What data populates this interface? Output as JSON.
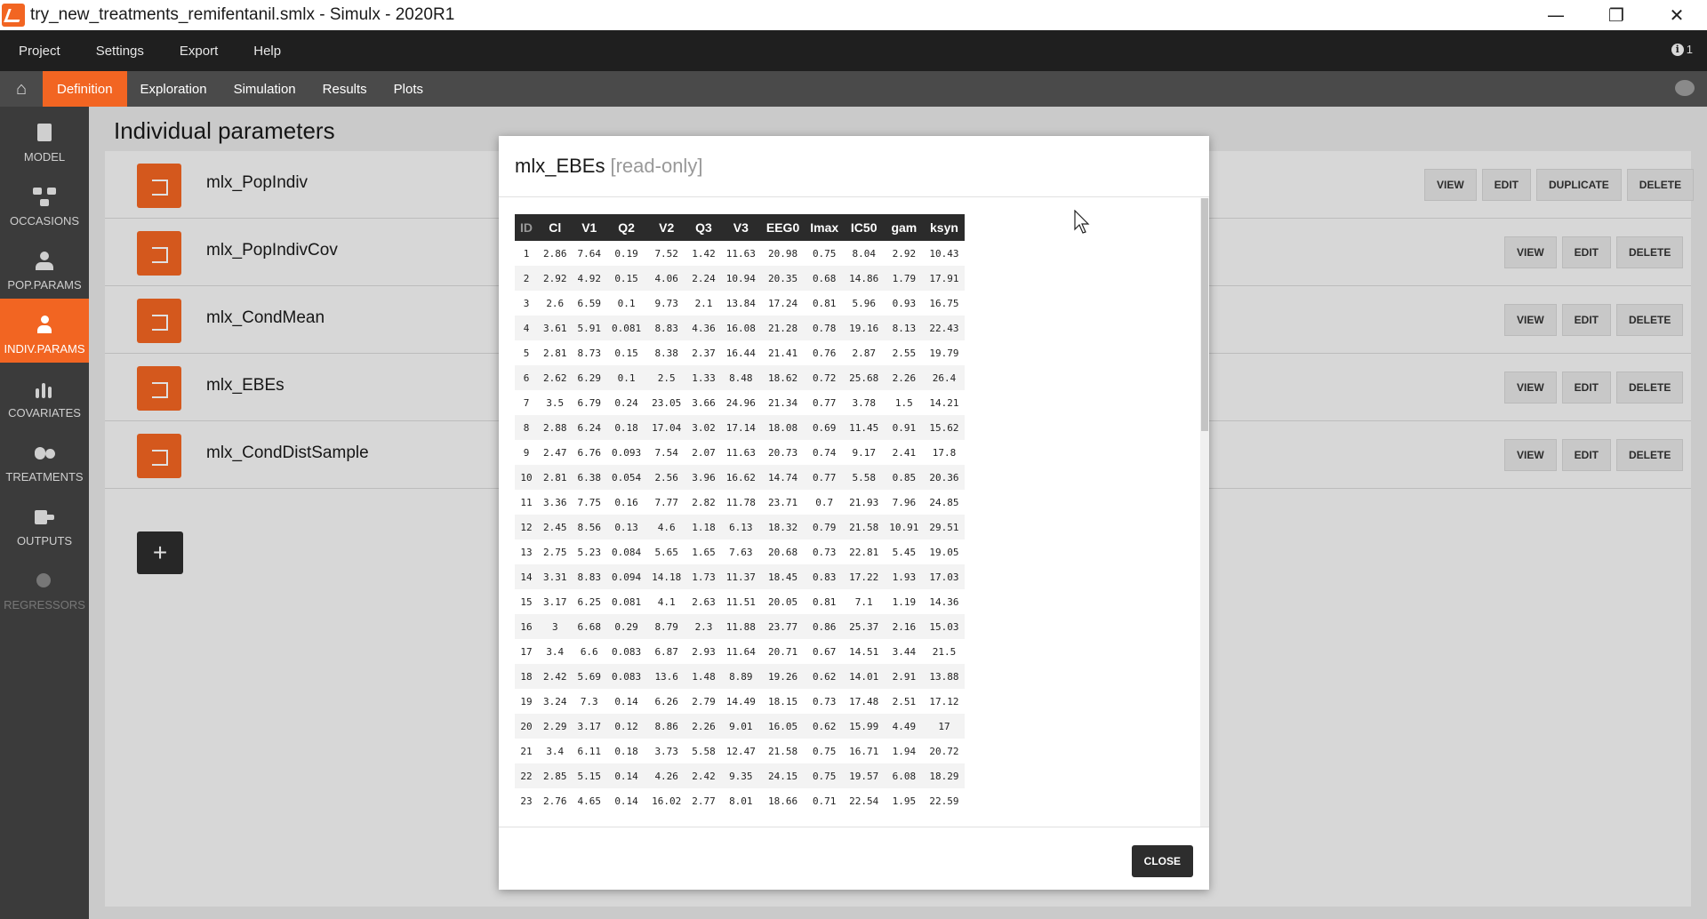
{
  "window": {
    "title": "try_new_treatments_remifentanil.smlx - Simulx - 2020R1"
  },
  "menu": {
    "items": [
      "Project",
      "Settings",
      "Export",
      "Help"
    ],
    "info_count": "1"
  },
  "tabs": {
    "items": [
      "Definition",
      "Exploration",
      "Simulation",
      "Results",
      "Plots"
    ],
    "active": "Definition"
  },
  "sidebar": {
    "items": [
      {
        "label": "MODEL",
        "icon": "model-icon"
      },
      {
        "label": "OCCASIONS",
        "icon": "occasions-icon"
      },
      {
        "label": "POP.PARAMS",
        "icon": "pop-params-icon"
      },
      {
        "label": "INDIV.PARAMS",
        "icon": "indiv-params-icon"
      },
      {
        "label": "COVARIATES",
        "icon": "covariates-icon"
      },
      {
        "label": "TREATMENTS",
        "icon": "treatments-icon"
      },
      {
        "label": "OUTPUTS",
        "icon": "outputs-icon"
      },
      {
        "label": "REGRESSORS",
        "icon": "regressors-icon"
      }
    ]
  },
  "page": {
    "title": "Individual parameters"
  },
  "parameter_sets": [
    {
      "name": "mlx_PopIndiv",
      "actions": [
        "VIEW",
        "EDIT",
        "DUPLICATE",
        "DELETE"
      ]
    },
    {
      "name": "mlx_PopIndivCov",
      "actions": [
        "VIEW",
        "EDIT",
        "DELETE"
      ]
    },
    {
      "name": "mlx_CondMean",
      "actions": [
        "VIEW",
        "EDIT",
        "DELETE"
      ]
    },
    {
      "name": "mlx_EBEs",
      "actions": [
        "VIEW",
        "EDIT",
        "DELETE"
      ]
    },
    {
      "name": "mlx_CondDistSample",
      "actions": [
        "VIEW",
        "EDIT",
        "DELETE"
      ]
    }
  ],
  "add_button": "+",
  "modal": {
    "title": "mlx_EBEs",
    "subtitle": "[read-only]",
    "close_label": "CLOSE",
    "columns": [
      "ID",
      "Cl",
      "V1",
      "Q2",
      "V2",
      "Q3",
      "V3",
      "EEG0",
      "Imax",
      "IC50",
      "gam",
      "ksyn"
    ],
    "rows": [
      [
        "1",
        "2.86",
        "7.64",
        "0.19",
        "7.52",
        "1.42",
        "11.63",
        "20.98",
        "0.75",
        "8.04",
        "2.92",
        "10.43"
      ],
      [
        "2",
        "2.92",
        "4.92",
        "0.15",
        "4.06",
        "2.24",
        "10.94",
        "20.35",
        "0.68",
        "14.86",
        "1.79",
        "17.91"
      ],
      [
        "3",
        "2.6",
        "6.59",
        "0.1",
        "9.73",
        "2.1",
        "13.84",
        "17.24",
        "0.81",
        "5.96",
        "0.93",
        "16.75"
      ],
      [
        "4",
        "3.61",
        "5.91",
        "0.081",
        "8.83",
        "4.36",
        "16.08",
        "21.28",
        "0.78",
        "19.16",
        "8.13",
        "22.43"
      ],
      [
        "5",
        "2.81",
        "8.73",
        "0.15",
        "8.38",
        "2.37",
        "16.44",
        "21.41",
        "0.76",
        "2.87",
        "2.55",
        "19.79"
      ],
      [
        "6",
        "2.62",
        "6.29",
        "0.1",
        "2.5",
        "1.33",
        "8.48",
        "18.62",
        "0.72",
        "25.68",
        "2.26",
        "26.4"
      ],
      [
        "7",
        "3.5",
        "6.79",
        "0.24",
        "23.05",
        "3.66",
        "24.96",
        "21.34",
        "0.77",
        "3.78",
        "1.5",
        "14.21"
      ],
      [
        "8",
        "2.88",
        "6.24",
        "0.18",
        "17.04",
        "3.02",
        "17.14",
        "18.08",
        "0.69",
        "11.45",
        "0.91",
        "15.62"
      ],
      [
        "9",
        "2.47",
        "6.76",
        "0.093",
        "7.54",
        "2.07",
        "11.63",
        "20.73",
        "0.74",
        "9.17",
        "2.41",
        "17.8"
      ],
      [
        "10",
        "2.81",
        "6.38",
        "0.054",
        "2.56",
        "3.96",
        "16.62",
        "14.74",
        "0.77",
        "5.58",
        "0.85",
        "20.36"
      ],
      [
        "11",
        "3.36",
        "7.75",
        "0.16",
        "7.77",
        "2.82",
        "11.78",
        "23.71",
        "0.7",
        "21.93",
        "7.96",
        "24.85"
      ],
      [
        "12",
        "2.45",
        "8.56",
        "0.13",
        "4.6",
        "1.18",
        "6.13",
        "18.32",
        "0.79",
        "21.58",
        "10.91",
        "29.51"
      ],
      [
        "13",
        "2.75",
        "5.23",
        "0.084",
        "5.65",
        "1.65",
        "7.63",
        "20.68",
        "0.73",
        "22.81",
        "5.45",
        "19.05"
      ],
      [
        "14",
        "3.31",
        "8.83",
        "0.094",
        "14.18",
        "1.73",
        "11.37",
        "18.45",
        "0.83",
        "17.22",
        "1.93",
        "17.03"
      ],
      [
        "15",
        "3.17",
        "6.25",
        "0.081",
        "4.1",
        "2.63",
        "11.51",
        "20.05",
        "0.81",
        "7.1",
        "1.19",
        "14.36"
      ],
      [
        "16",
        "3",
        "6.68",
        "0.29",
        "8.79",
        "2.3",
        "11.88",
        "23.77",
        "0.86",
        "25.37",
        "2.16",
        "15.03"
      ],
      [
        "17",
        "3.4",
        "6.6",
        "0.083",
        "6.87",
        "2.93",
        "11.64",
        "20.71",
        "0.67",
        "14.51",
        "3.44",
        "21.5"
      ],
      [
        "18",
        "2.42",
        "5.69",
        "0.083",
        "13.6",
        "1.48",
        "8.89",
        "19.26",
        "0.62",
        "14.01",
        "2.91",
        "13.88"
      ],
      [
        "19",
        "3.24",
        "7.3",
        "0.14",
        "6.26",
        "2.79",
        "14.49",
        "18.15",
        "0.73",
        "17.48",
        "2.51",
        "17.12"
      ],
      [
        "20",
        "2.29",
        "3.17",
        "0.12",
        "8.86",
        "2.26",
        "9.01",
        "16.05",
        "0.62",
        "15.99",
        "4.49",
        "17"
      ],
      [
        "21",
        "3.4",
        "6.11",
        "0.18",
        "3.73",
        "5.58",
        "12.47",
        "21.58",
        "0.75",
        "16.71",
        "1.94",
        "20.72"
      ],
      [
        "22",
        "2.85",
        "5.15",
        "0.14",
        "4.26",
        "2.42",
        "9.35",
        "24.15",
        "0.75",
        "19.57",
        "6.08",
        "18.29"
      ],
      [
        "23",
        "2.76",
        "4.65",
        "0.14",
        "16.02",
        "2.77",
        "8.01",
        "18.66",
        "0.71",
        "22.54",
        "1.95",
        "22.59"
      ]
    ]
  },
  "colors": {
    "accent": "#f26522",
    "menubar": "#1f1f1f",
    "tabbar": "#4a4a4a",
    "sidebar": "#3b3b3b"
  }
}
